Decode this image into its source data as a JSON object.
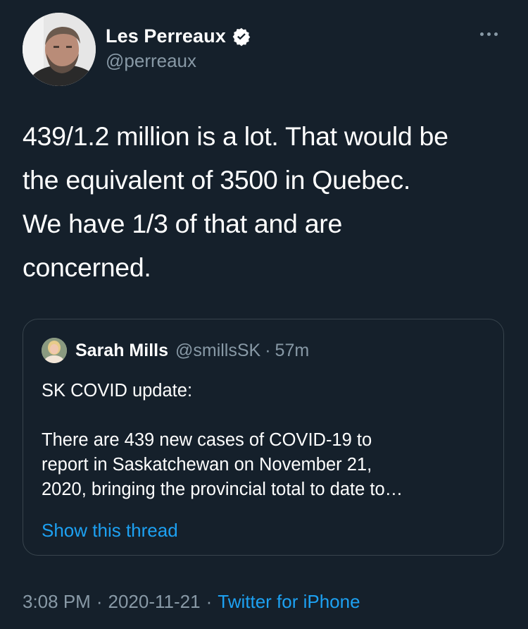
{
  "author": {
    "display_name": "Les Perreaux",
    "handle": "@perreaux",
    "verified": true
  },
  "tweet": {
    "text": "439/1.2 million is a lot. That would be\nthe equivalent of 3500 in Quebec.\nWe have 1/3 of that and are\nconcerned."
  },
  "quoted_tweet": {
    "display_name": "Sarah Mills",
    "handle": "@smillsSK",
    "separator": "·",
    "time": "57m",
    "text": "SK COVID update:\n\nThere are 439 new cases of COVID-19 to\nreport in Saskatchewan on November 21,\n2020, bringing the provincial total to date to…",
    "show_thread_label": "Show this thread"
  },
  "meta": {
    "time": "3:08 PM",
    "separator": "·",
    "date": "2020-11-21",
    "source": "Twitter for iPhone"
  },
  "colors": {
    "background": "#15202b",
    "secondary_text": "#8899a6",
    "link": "#1da1f2",
    "border": "#38444d"
  }
}
